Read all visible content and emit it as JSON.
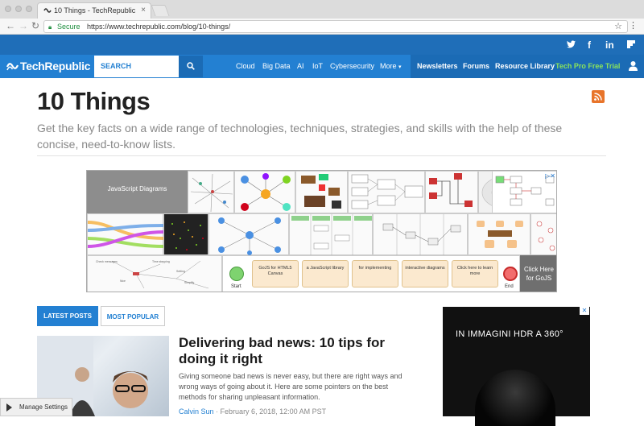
{
  "browser": {
    "tab_title": "10 Things - TechRepublic",
    "secure_label": "Secure",
    "url": "https://www.techrepublic.com/blog/10-things/"
  },
  "social": {
    "twitter": "𝕥",
    "facebook": "f",
    "linkedin": "in",
    "flipboard": "▮"
  },
  "header": {
    "logo": "TechRepublic",
    "search_placeholder": "SEARCH",
    "nav": [
      "Cloud",
      "Big Data",
      "AI",
      "IoT",
      "Cybersecurity",
      "More"
    ],
    "right_nav": [
      "Newsletters",
      "Forums",
      "Resource Library",
      "Tech Pro Free Trial"
    ]
  },
  "page": {
    "title": "10 Things",
    "description": "Get the key facts on a wide range of technologies, techniques, strategies, and skills with the help of these concise, need-to-know lists."
  },
  "ad_banner": {
    "headline": "JavaScript Diagrams",
    "cta": "Click Here for GoJS",
    "flow_start": "Start",
    "flow_end": "End",
    "flow_steps": [
      "GoJS for HTML5 Canvas",
      "a JavaScript library",
      "for implementing",
      "interactive diagrams",
      "Click here to learn more"
    ]
  },
  "tabs": {
    "latest": "LATEST POSTS",
    "popular": "MOST POPULAR"
  },
  "article": {
    "title": "Delivering bad news: 10 tips for doing it right",
    "excerpt": "Giving someone bad news is never easy, but there are right ways and wrong ways of going about it. Here are some pointers on the best methods for sharing unpleasant information.",
    "author": "Calvin Sun",
    "date": "February 6, 2018, 12:00 AM PST"
  },
  "side_ad": {
    "text": "IN IMMAGINI HDR A 360°"
  },
  "manage_settings": "Manage Settings",
  "colors": {
    "brand_blue": "#2380d2",
    "header_dark": "#1f6eb8",
    "pro_green": "#8be35a",
    "rss_orange": "#e8742a"
  }
}
